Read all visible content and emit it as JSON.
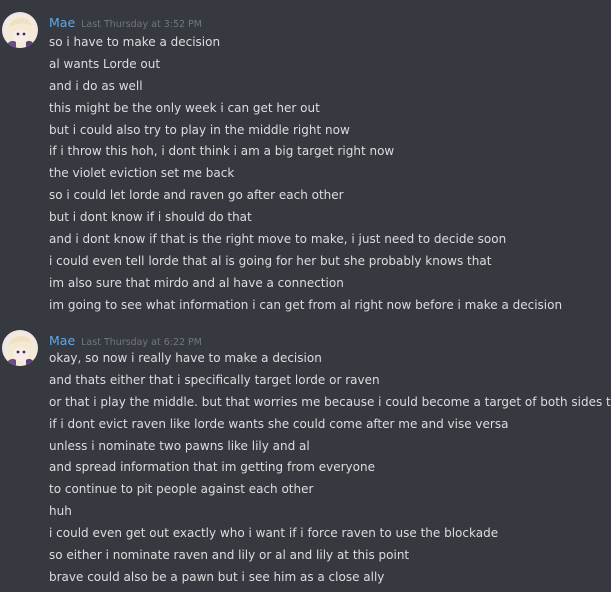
{
  "groups": [
    {
      "username": "Mae",
      "timestamp": "Last Thursday at 3:52 PM",
      "lines": [
        "so i have to make a decision",
        "al wants Lorde out",
        "and i do as well",
        "this might be the only week i can get her out",
        "but i could also try to play in the middle right now",
        "if i throw this hoh, i dont think i am a big target right now",
        "the violet eviction set me back",
        "so i could let lorde and raven go after each other",
        "but i dont know if i should do that",
        "and i dont know if that is the right move to make, i just need to decide soon",
        "i could even tell lorde that al is going for her but she probably knows that",
        "im also sure that mirdo and al have a connection",
        "im going to see what information i can get from al right now before i make a decision"
      ]
    },
    {
      "username": "Mae",
      "timestamp": "Last Thursday at 6:22 PM",
      "lines": [
        "okay, so now i really have to make a decision",
        "and thats either that i specifically target lorde or raven",
        "or that i play the middle. but that worries me because i could become a target of both sides then",
        "if i dont evict raven like lorde wants she could come after me and vise versa",
        "unless i nominate two pawns like lily and al",
        "and spread information that im getting from everyone",
        "to continue to pit people against each other",
        "huh",
        "i could even get out exactly who i want if i force raven to use the blockade",
        "so either i nominate raven and lily or al and lily at this point",
        "brave could also be a pawn but i see him as a close ally"
      ]
    }
  ]
}
